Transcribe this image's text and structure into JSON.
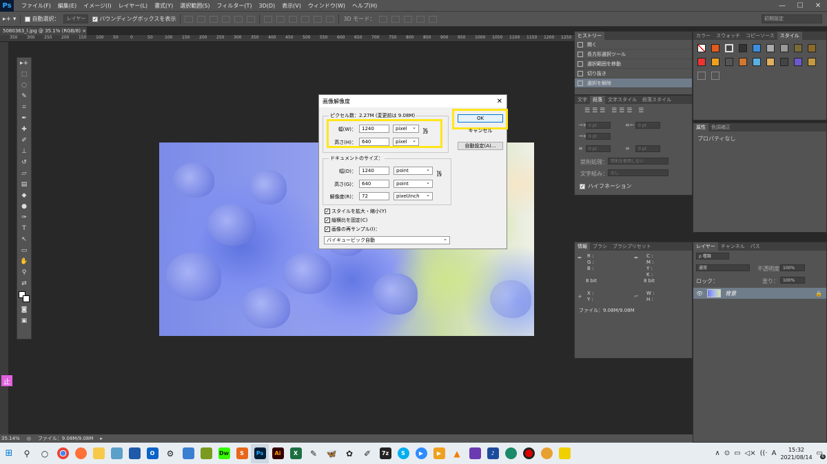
{
  "menubar": {
    "logo": "Ps",
    "items": [
      "ファイル(F)",
      "編集(E)",
      "イメージ(I)",
      "レイヤー(L)",
      "書式(Y)",
      "選択範囲(S)",
      "フィルター(T)",
      "3D(D)",
      "表示(V)",
      "ウィンドウ(W)",
      "ヘルプ(H)"
    ]
  },
  "options": {
    "auto_select_label": "自動選択：",
    "auto_select_target": "レイヤー",
    "bbox_label": "バウンディングボックスを表示",
    "mode_3d": "3D モード：",
    "workspace": "初期設定"
  },
  "document": {
    "tab_label": "5080363_l.jpg @ 35.1% (RGB/8)",
    "ruler_ticks": [
      "350",
      "300",
      "250",
      "200",
      "150",
      "100",
      "50",
      "0",
      "50",
      "100",
      "150",
      "200",
      "250",
      "300",
      "350",
      "400",
      "450",
      "500",
      "550",
      "600",
      "650",
      "700",
      "750",
      "800",
      "850",
      "900",
      "950",
      "1000",
      "1050",
      "1100",
      "1150",
      "1200",
      "1250"
    ]
  },
  "status": {
    "zoom": "35.14%",
    "file": "ファイル：9.08M/9.08M"
  },
  "stop_badge": "止",
  "dialog": {
    "title": "画像解像度",
    "pixel_group": "ピクセル数：2.27M (変更前は 9.08M)",
    "px_width_label": "幅(W)：",
    "px_width_value": "1240",
    "px_width_unit": "pixel",
    "px_height_label": "高さ(H)：",
    "px_height_value": "640",
    "px_height_unit": "pixel",
    "doc_group": "ドキュメントのサイズ：",
    "doc_width_label": "幅(D)：",
    "doc_width_value": "1240",
    "doc_width_unit": "point",
    "doc_height_label": "高さ(G)：",
    "doc_height_value": "640",
    "doc_height_unit": "point",
    "res_label": "解像度(R)：",
    "res_value": "72",
    "res_unit": "pixel/inch",
    "check_scale": "スタイルを拡大・縮小(Y)",
    "check_constrain": "縦横比を固定(C)",
    "check_resample": "画像の再サンプル(I)：",
    "resample_method": "バイキュービック自動",
    "ok": "OK",
    "cancel": "キャンセル",
    "auto": "自動設定(A)..."
  },
  "history": {
    "tab": "ヒストリー",
    "items": [
      "開く",
      "長方形選択ツール",
      "選択範囲を移動",
      "切り抜き",
      "選択を解除"
    ]
  },
  "color_panel": {
    "tabs": [
      "カラー",
      "スウォッチ",
      "コピーソース",
      "スタイル"
    ]
  },
  "character": {
    "tabs": [
      "文字",
      "段落",
      "文字スタイル",
      "段落スタイル"
    ],
    "fields": [
      "0 pt",
      "0 pt",
      "0 pt",
      "0 pt",
      "0 pt"
    ],
    "kinsoku_label": "禁則処理：",
    "kinsoku_value": "禁則を使用しない",
    "mojikumi_label": "文字組み：",
    "mojikumi_value": "なし",
    "hyphenation": "ハイフネーション"
  },
  "properties": {
    "tabs": [
      "属性",
      "色調補正"
    ],
    "empty": "プロパティなし"
  },
  "info_panel": {
    "tabs": [
      "情報",
      "ブラシ",
      "ブラシプリセット"
    ],
    "rgb": "R :\nG :\nB :",
    "cmyk": "C :\nM :\nY :\nK :",
    "bit1": "8 bit",
    "bit2": "8 bit",
    "xy": "X :\nY :",
    "wh": "W :\nH :",
    "file": "ファイル：9.08M/9.08M"
  },
  "layers": {
    "tabs": [
      "レイヤー",
      "チャンネル",
      "パス"
    ],
    "kind": "ρ 種類",
    "blend": "通常",
    "opacity_label": "不透明度：",
    "opacity": "100%",
    "lock_label": "ロック：",
    "fill_label": "塗り：",
    "fill": "100%",
    "layer_name": "背景"
  },
  "taskbar": {
    "time": "15:32",
    "date": "2021/08/14",
    "notify_count": "6",
    "ime": "A"
  },
  "colors": {
    "highlight": "#ffe619",
    "ok_border": "#0078d7",
    "ps_blue": "#31a8ff"
  }
}
